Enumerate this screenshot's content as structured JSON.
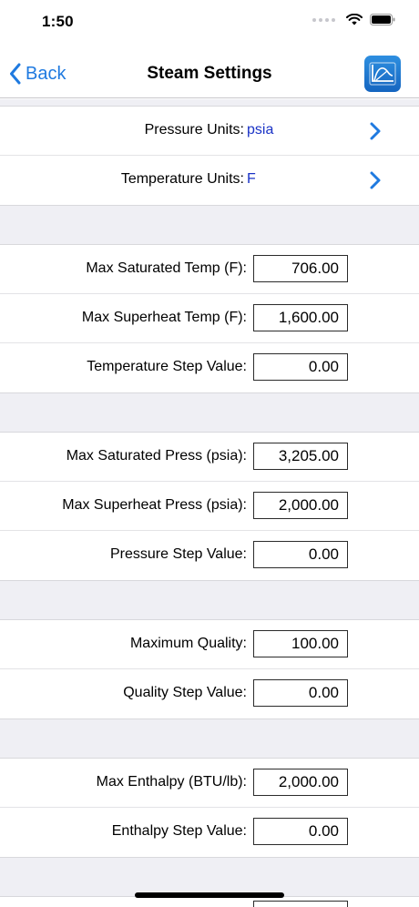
{
  "status": {
    "time": "1:50"
  },
  "nav": {
    "back_label": "Back",
    "title": "Steam Settings",
    "app_icon": "curve-chart-icon"
  },
  "units": [
    {
      "label": "Pressure Units:",
      "value": "psia"
    },
    {
      "label": "Temperature Units:",
      "value": "F"
    }
  ],
  "temperature": [
    {
      "label": "Max Saturated Temp (F):",
      "value": "706.00"
    },
    {
      "label": "Max Superheat Temp (F):",
      "value": "1,600.00"
    },
    {
      "label": "Temperature Step Value:",
      "value": "0.00"
    }
  ],
  "pressure": [
    {
      "label": "Max Saturated Press (psia):",
      "value": "3,205.00"
    },
    {
      "label": "Max Superheat Press (psia):",
      "value": "2,000.00"
    },
    {
      "label": "Pressure Step Value:",
      "value": "0.00"
    }
  ],
  "quality": [
    {
      "label": "Maximum Quality:",
      "value": "100.00"
    },
    {
      "label": "Quality Step Value:",
      "value": "0.00"
    }
  ],
  "enthalpy": [
    {
      "label": "Max Enthalpy (BTU/lb):",
      "value": "2,000.00"
    },
    {
      "label": "Enthalpy Step Value:",
      "value": "0.00"
    }
  ],
  "colors": {
    "accent": "#1f7ae0",
    "unit_value": "#1a33c6",
    "separator": "#efeff4"
  }
}
